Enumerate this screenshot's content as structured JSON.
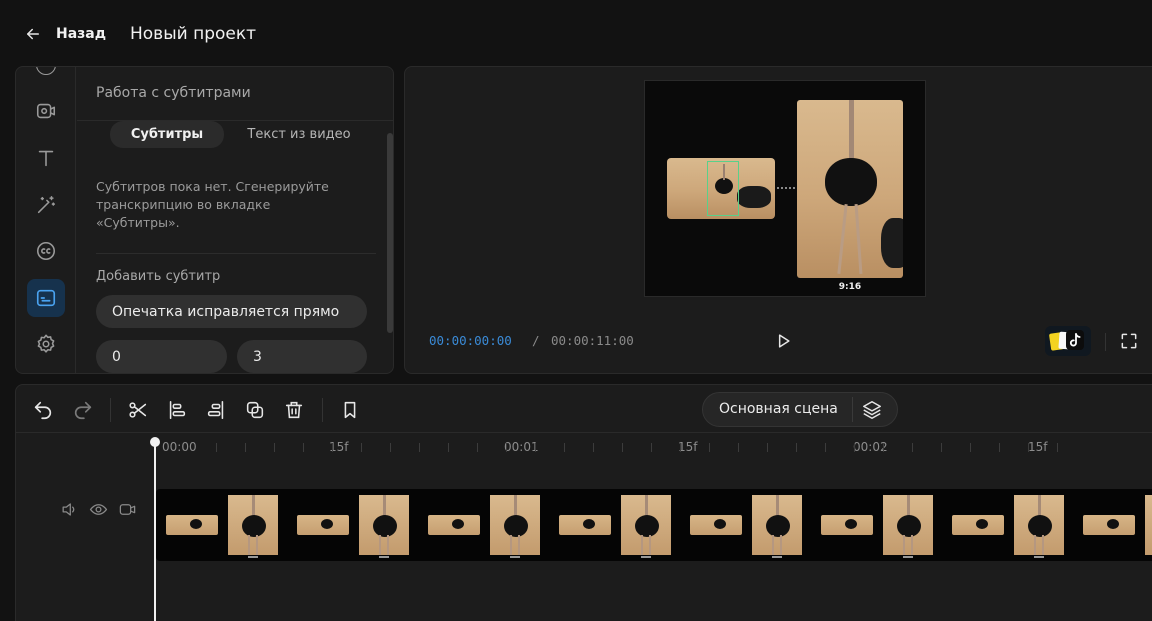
{
  "header": {
    "back_label": "Назад",
    "project_title": "Новый проект"
  },
  "left_panel": {
    "rail": [
      "record-icon",
      "text-icon",
      "magic-wand-icon",
      "cc-icon",
      "subtitles-icon",
      "settings-icon"
    ],
    "title": "Работа с субтитрами",
    "tabs": [
      {
        "label": "Субтитры",
        "active": true
      },
      {
        "label": "Текст из видео",
        "active": false
      }
    ],
    "empty_message": "Субтитров пока нет. Сгенерируйте транскрипцию во вкладке «Субтитры».",
    "add_label": "Добавить субтитр",
    "subtitle_text_value": "Опечатка исправляется прямо",
    "start_value": "0",
    "end_value": "3"
  },
  "preview": {
    "aspect_label": "9:16",
    "time_current": "00:00:00:00",
    "time_separator": "/",
    "time_total": "00:00:11:00",
    "accent": "#3a8ad6"
  },
  "timeline": {
    "scene_label": "Основная сцена",
    "ticks": [
      {
        "label": "00:00"
      },
      {
        "label": "15f"
      },
      {
        "label": "00:01"
      },
      {
        "label": "15f"
      },
      {
        "label": "00:02"
      },
      {
        "label": "15f"
      }
    ]
  }
}
